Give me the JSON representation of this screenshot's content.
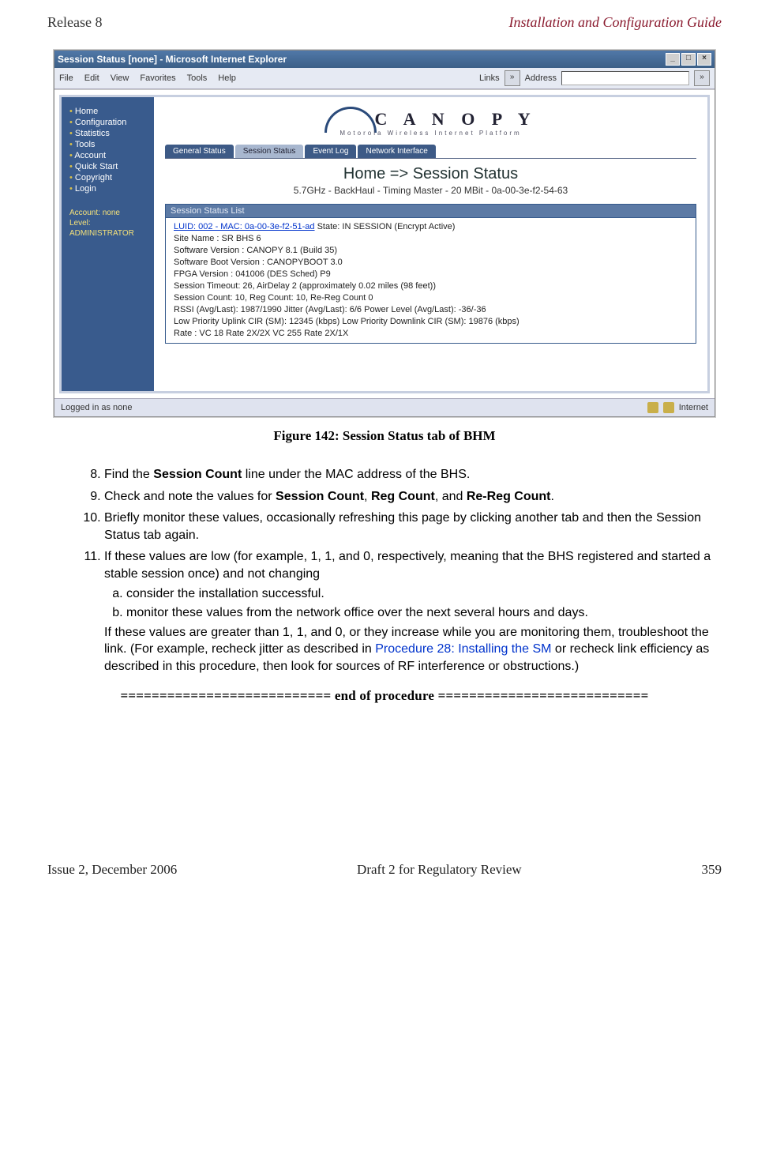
{
  "header": {
    "left": "Release 8",
    "right": "Installation and Configuration Guide"
  },
  "window": {
    "title": "Session Status [none] - Microsoft Internet Explorer",
    "menus": [
      "File",
      "Edit",
      "View",
      "Favorites",
      "Tools",
      "Help"
    ],
    "links_label": "Links",
    "address_label": "Address",
    "go_label": "»"
  },
  "logo": {
    "name": "C A N O P Y",
    "tagline": "Motorola Wireless Internet Platform"
  },
  "nav": {
    "items": [
      "Home",
      "Configuration",
      "Statistics",
      "Tools",
      "Account",
      "Quick Start",
      "Copyright",
      "Login"
    ],
    "account_line1": "Account: none",
    "account_line2": "Level: ADMINISTRATOR"
  },
  "tabs": [
    "General Status",
    "Session Status",
    "Event Log",
    "Network Interface"
  ],
  "page_title": "Home => Session Status",
  "page_sub": "5.7GHz - BackHaul - Timing Master - 20 MBit - 0a-00-3e-f2-54-63",
  "panel": {
    "title": "Session Status List",
    "luid_link": "LUID: 002 - MAC: 0a-00-3e-f2-51-ad",
    "state": " State: IN SESSION (Encrypt Active)",
    "line_site": "Site Name : SR BHS 6",
    "line_sw": "Software Version : CANOPY 8.1 (Build 35)",
    "line_boot": "Software Boot Version : CANOPYBOOT 3.0",
    "line_fpga": "FPGA Version : 041006 (DES Sched) P9",
    "line_timeout": "Session Timeout: 26, AirDelay 2 (approximately 0.02 miles (98 feet))",
    "line_count": "Session Count: 10, Reg Count: 10, Re-Reg Count 0",
    "line_rssi": "RSSI (Avg/Last): 1987/1990   Jitter (Avg/Last): 6/6   Power Level (Avg/Last): -36/-36",
    "line_cir": "Low Priority Uplink CIR (SM): 12345 (kbps) Low Priority Downlink CIR (SM): 19876 (kbps)",
    "line_rate": "Rate : VC 18 Rate 2X/2X      VC 255 Rate 2X/1X"
  },
  "statusbar": {
    "left": "Logged in as none",
    "right": "Internet"
  },
  "figure_caption": "Figure 142: Session Status tab of BHM",
  "steps": {
    "s8_pre": "Find the ",
    "s8_b": "Session Count",
    "s8_post": " line under the MAC address of the BHS.",
    "s9_pre": "Check and note the values for ",
    "s9_b1": "Session Count",
    "s9_m1": ", ",
    "s9_b2": "Reg Count",
    "s9_m2": ", and ",
    "s9_b3": "Re-Reg Count",
    "s9_post": ".",
    "s10": "Briefly monitor these values, occasionally refreshing this page by clicking another tab and then the Session Status tab again.",
    "s11_intro": "If these values are low (for example, 1, 1, and 0, respectively, meaning that the BHS registered and started a stable session once) and not changing",
    "s11a": "consider the installation successful.",
    "s11b": "monitor these values from the network office over the next several hours and days.",
    "s11_tail_pre": "If these values are greater than 1, 1, and 0, or they increase while you are monitoring them, troubleshoot the link. (For example, recheck jitter as described in ",
    "s11_tail_link": "Procedure 28: Installing the SM",
    "s11_tail_post": " or recheck link efficiency as described in this procedure, then look for sources of RF interference or obstructions.)"
  },
  "end_of_procedure": "=========================== end of procedure ===========================",
  "footer": {
    "left": "Issue 2, December 2006",
    "center": "Draft 2 for Regulatory Review",
    "right": "359"
  }
}
